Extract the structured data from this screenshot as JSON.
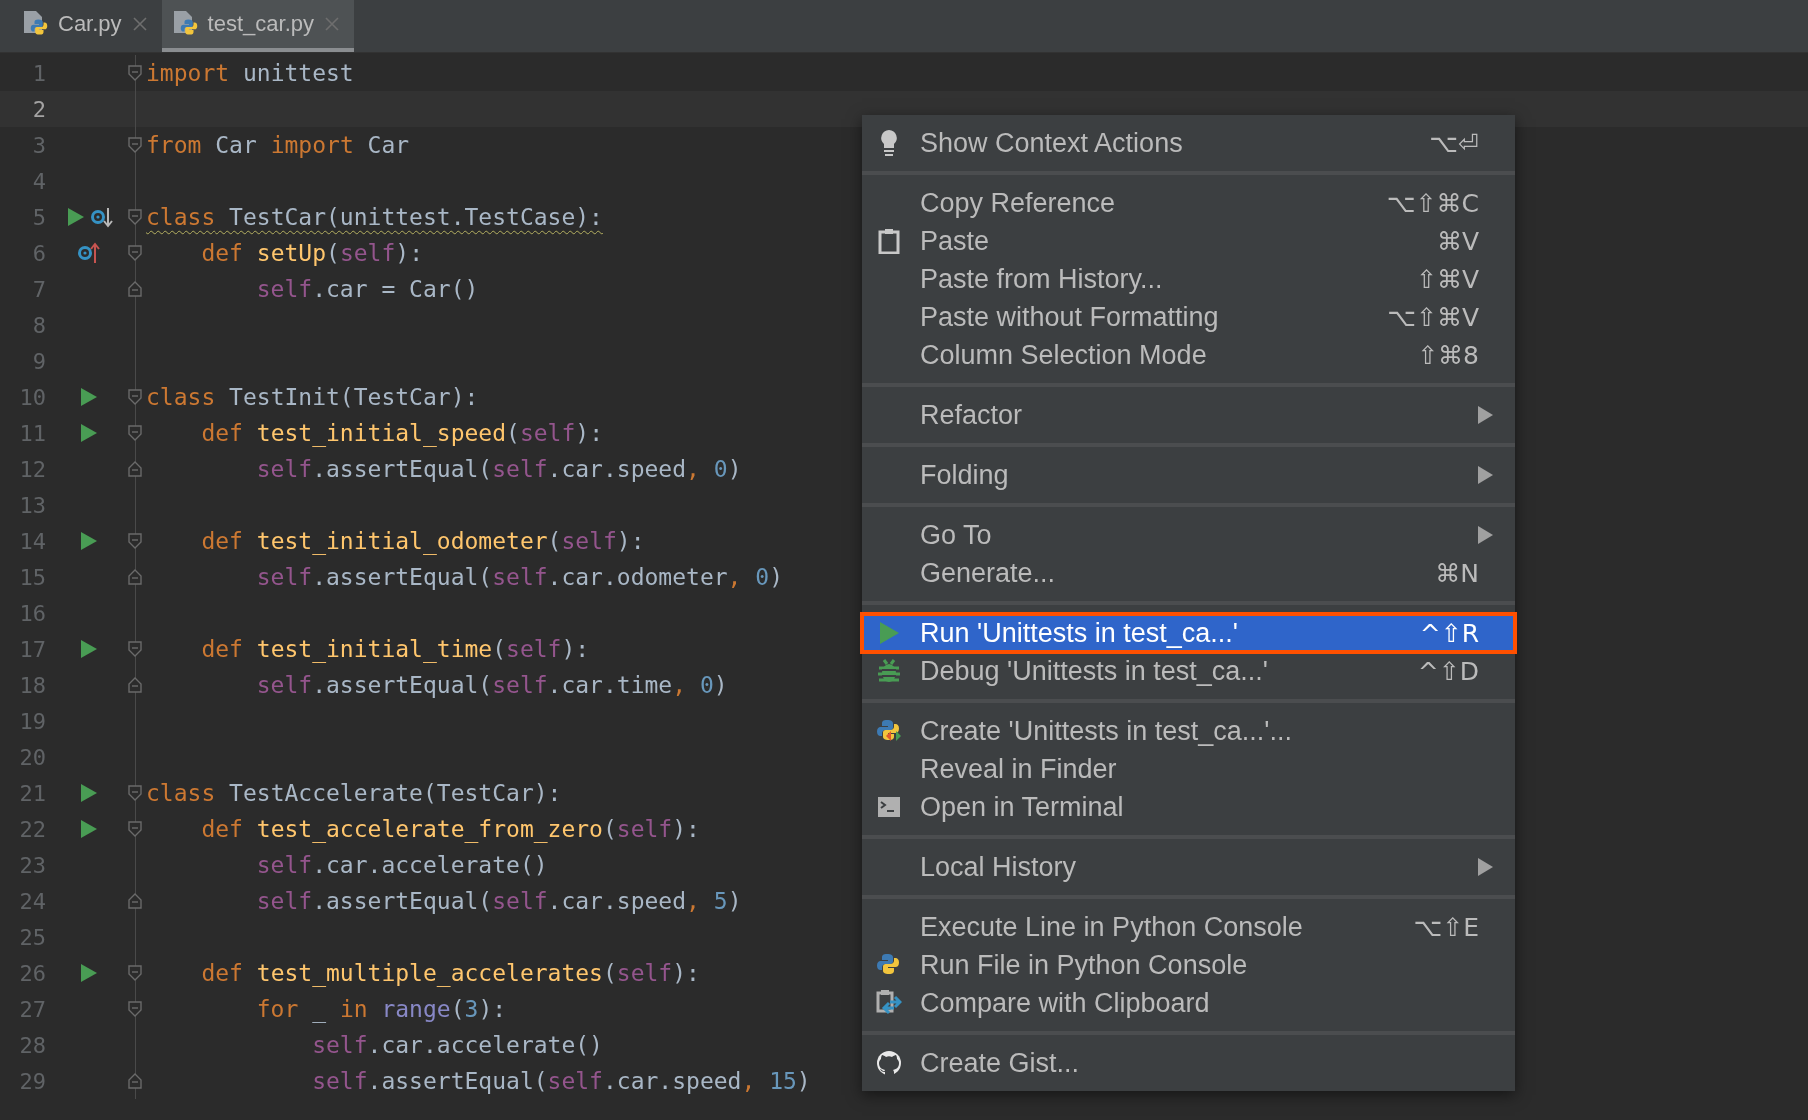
{
  "tabs": [
    {
      "label": "Car.py",
      "selected": false
    },
    {
      "label": "test_car.py",
      "selected": true
    }
  ],
  "editor": {
    "lines": [
      {
        "number": "1",
        "fold_start": true,
        "code": [
          {
            "kind": "kw",
            "text": "import"
          },
          {
            "kind": "plain",
            "text": " unittest"
          }
        ]
      },
      {
        "number": "2",
        "current": true
      },
      {
        "number": "3",
        "fold_start": true,
        "code": [
          {
            "kind": "kw",
            "text": "from"
          },
          {
            "kind": "plain",
            "text": " Car "
          },
          {
            "kind": "kw",
            "text": "import"
          },
          {
            "kind": "plain",
            "text": " Car"
          }
        ]
      },
      {
        "number": "4"
      },
      {
        "number": "5",
        "markers": [
          {
            "kind": "run"
          },
          {
            "kind": "overridden"
          }
        ],
        "fold_start": true,
        "warning": true,
        "code": [
          {
            "kind": "kw",
            "text": "class"
          },
          {
            "kind": "plain",
            "text": " TestCar(unittest.TestCase):"
          }
        ]
      },
      {
        "number": "6",
        "markers": [
          {
            "kind": "overriding"
          }
        ],
        "fold_start": true,
        "code": [
          {
            "kind": "kw",
            "text": "    def "
          },
          {
            "kind": "fn",
            "text": "setUp"
          },
          {
            "kind": "plain",
            "text": "("
          },
          {
            "kind": "self",
            "text": "self"
          },
          {
            "kind": "plain",
            "text": "):"
          }
        ]
      },
      {
        "number": "7",
        "fold_end": true,
        "code": [
          {
            "kind": "self",
            "text": "        self"
          },
          {
            "kind": "plain",
            "text": ".car = Car()"
          }
        ]
      },
      {
        "number": "8"
      },
      {
        "number": "9"
      },
      {
        "number": "10",
        "markers": [
          {
            "kind": "run"
          }
        ],
        "fold_start": true,
        "code": [
          {
            "kind": "kw",
            "text": "class"
          },
          {
            "kind": "plain",
            "text": " TestInit(TestCar):"
          }
        ]
      },
      {
        "number": "11",
        "markers": [
          {
            "kind": "run"
          }
        ],
        "fold_start": true,
        "code": [
          {
            "kind": "kw",
            "text": "    def "
          },
          {
            "kind": "fn",
            "text": "test_initial_speed"
          },
          {
            "kind": "plain",
            "text": "("
          },
          {
            "kind": "self",
            "text": "self"
          },
          {
            "kind": "plain",
            "text": "):"
          }
        ]
      },
      {
        "number": "12",
        "fold_end": true,
        "code": [
          {
            "kind": "self",
            "text": "        self"
          },
          {
            "kind": "plain",
            "text": ".assertEqual("
          },
          {
            "kind": "self",
            "text": "self"
          },
          {
            "kind": "plain",
            "text": ".car.speed"
          },
          {
            "kind": "kw",
            "text": ", "
          },
          {
            "kind": "num",
            "text": "0"
          },
          {
            "kind": "plain",
            "text": ")"
          }
        ]
      },
      {
        "number": "13"
      },
      {
        "number": "14",
        "markers": [
          {
            "kind": "run"
          }
        ],
        "fold_start": true,
        "code": [
          {
            "kind": "kw",
            "text": "    def "
          },
          {
            "kind": "fn",
            "text": "test_initial_odometer"
          },
          {
            "kind": "plain",
            "text": "("
          },
          {
            "kind": "self",
            "text": "self"
          },
          {
            "kind": "plain",
            "text": "):"
          }
        ]
      },
      {
        "number": "15",
        "fold_end": true,
        "code": [
          {
            "kind": "self",
            "text": "        self"
          },
          {
            "kind": "plain",
            "text": ".assertEqual("
          },
          {
            "kind": "self",
            "text": "self"
          },
          {
            "kind": "plain",
            "text": ".car.odometer"
          },
          {
            "kind": "kw",
            "text": ", "
          },
          {
            "kind": "num",
            "text": "0"
          },
          {
            "kind": "plain",
            "text": ")"
          }
        ]
      },
      {
        "number": "16"
      },
      {
        "number": "17",
        "markers": [
          {
            "kind": "run"
          }
        ],
        "fold_start": true,
        "code": [
          {
            "kind": "kw",
            "text": "    def "
          },
          {
            "kind": "fn",
            "text": "test_initial_time"
          },
          {
            "kind": "plain",
            "text": "("
          },
          {
            "kind": "self",
            "text": "self"
          },
          {
            "kind": "plain",
            "text": "):"
          }
        ]
      },
      {
        "number": "18",
        "fold_end": true,
        "code": [
          {
            "kind": "self",
            "text": "        self"
          },
          {
            "kind": "plain",
            "text": ".assertEqual("
          },
          {
            "kind": "self",
            "text": "self"
          },
          {
            "kind": "plain",
            "text": ".car.time"
          },
          {
            "kind": "kw",
            "text": ", "
          },
          {
            "kind": "num",
            "text": "0"
          },
          {
            "kind": "plain",
            "text": ")"
          }
        ]
      },
      {
        "number": "19"
      },
      {
        "number": "20"
      },
      {
        "number": "21",
        "markers": [
          {
            "kind": "run"
          }
        ],
        "fold_start": true,
        "code": [
          {
            "kind": "kw",
            "text": "class"
          },
          {
            "kind": "plain",
            "text": " TestAccelerate(TestCar):"
          }
        ]
      },
      {
        "number": "22",
        "markers": [
          {
            "kind": "run"
          }
        ],
        "fold_start": true,
        "code": [
          {
            "kind": "kw",
            "text": "    def "
          },
          {
            "kind": "fn",
            "text": "test_accelerate_from_zero"
          },
          {
            "kind": "plain",
            "text": "("
          },
          {
            "kind": "self",
            "text": "self"
          },
          {
            "kind": "plain",
            "text": "):"
          }
        ]
      },
      {
        "number": "23",
        "code": [
          {
            "kind": "self",
            "text": "        self"
          },
          {
            "kind": "plain",
            "text": ".car.accelerate()"
          }
        ]
      },
      {
        "number": "24",
        "fold_end": true,
        "code": [
          {
            "kind": "self",
            "text": "        self"
          },
          {
            "kind": "plain",
            "text": ".assertEqual("
          },
          {
            "kind": "self",
            "text": "self"
          },
          {
            "kind": "plain",
            "text": ".car.speed"
          },
          {
            "kind": "kw",
            "text": ", "
          },
          {
            "kind": "num",
            "text": "5"
          },
          {
            "kind": "plain",
            "text": ")"
          }
        ]
      },
      {
        "number": "25"
      },
      {
        "number": "26",
        "markers": [
          {
            "kind": "run"
          }
        ],
        "fold_start": true,
        "code": [
          {
            "kind": "kw",
            "text": "    def "
          },
          {
            "kind": "fn",
            "text": "test_multiple_accelerates"
          },
          {
            "kind": "plain",
            "text": "("
          },
          {
            "kind": "self",
            "text": "self"
          },
          {
            "kind": "plain",
            "text": "):"
          }
        ]
      },
      {
        "number": "27",
        "fold_start": true,
        "code": [
          {
            "kind": "kw",
            "text": "        for"
          },
          {
            "kind": "plain",
            "text": " _ "
          },
          {
            "kind": "kw",
            "text": "in "
          },
          {
            "kind": "builtin",
            "text": "range"
          },
          {
            "kind": "plain",
            "text": "("
          },
          {
            "kind": "num",
            "text": "3"
          },
          {
            "kind": "plain",
            "text": "):"
          }
        ]
      },
      {
        "number": "28",
        "code": [
          {
            "kind": "self",
            "text": "            self"
          },
          {
            "kind": "plain",
            "text": ".car.accelerate()"
          }
        ]
      },
      {
        "number": "29",
        "fold_end": true,
        "code": [
          {
            "kind": "self",
            "text": "            self"
          },
          {
            "kind": "plain",
            "text": ".assertEqual("
          },
          {
            "kind": "self",
            "text": "self"
          },
          {
            "kind": "plain",
            "text": ".car.speed"
          },
          {
            "kind": "kw",
            "text": ", "
          },
          {
            "kind": "num",
            "text": "15"
          },
          {
            "kind": "plain",
            "text": ")"
          }
        ]
      }
    ]
  },
  "context_menu": {
    "groups": [
      {
        "items": [
          {
            "label": "Show Context Actions",
            "shortcut": "⌥⏎",
            "kind": "bulb",
            "selected": false
          }
        ]
      },
      {
        "items": [
          {
            "label": "Copy Reference",
            "shortcut": "⌥⇧⌘C",
            "selected": false
          },
          {
            "label": "Paste",
            "shortcut": "⌘V",
            "kind": "clipboard",
            "selected": false
          },
          {
            "label": "Paste from History...",
            "shortcut": "⇧⌘V",
            "selected": false
          },
          {
            "label": "Paste without Formatting",
            "shortcut": "⌥⇧⌘V",
            "selected": false
          },
          {
            "label": "Column Selection Mode",
            "shortcut": "⇧⌘8",
            "selected": false
          }
        ]
      },
      {
        "items": [
          {
            "label": "Refactor",
            "submenu": true,
            "selected": false
          }
        ]
      },
      {
        "items": [
          {
            "label": "Folding",
            "submenu": true,
            "selected": false
          }
        ]
      },
      {
        "items": [
          {
            "label": "Go To",
            "submenu": true,
            "selected": false
          },
          {
            "label": "Generate...",
            "shortcut": "⌘N",
            "selected": false
          }
        ]
      },
      {
        "items": [
          {
            "label": "Run 'Unittests in test_ca...'",
            "shortcut": "^⇧R",
            "kind": "run",
            "selected": true
          },
          {
            "label": "Debug 'Unittests in test_ca...'",
            "shortcut": "^⇧D",
            "kind": "bug",
            "selected": false
          }
        ]
      },
      {
        "items": [
          {
            "label": "Create 'Unittests in test_ca...'...",
            "kind": "create",
            "selected": false
          },
          {
            "label": "Reveal in Finder",
            "selected": false
          },
          {
            "label": "Open in Terminal",
            "kind": "terminal",
            "selected": false
          }
        ]
      },
      {
        "items": [
          {
            "label": "Local History",
            "submenu": true,
            "selected": false
          }
        ]
      },
      {
        "items": [
          {
            "label": "Execute Line in Python Console",
            "shortcut": "⌥⇧E",
            "selected": false
          },
          {
            "label": "Run File in Python Console",
            "kind": "python",
            "selected": false
          },
          {
            "label": "Compare with Clipboard",
            "kind": "compare",
            "selected": false
          }
        ]
      },
      {
        "items": [
          {
            "label": "Create Gist...",
            "kind": "gist",
            "selected": false
          }
        ]
      }
    ]
  }
}
